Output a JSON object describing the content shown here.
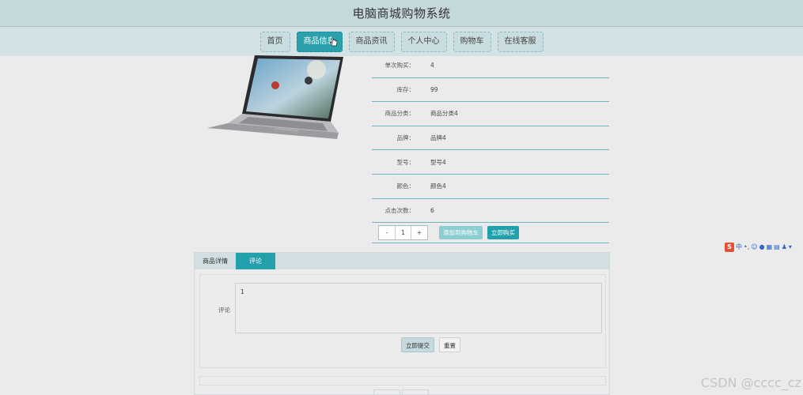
{
  "header": {
    "title": "电脑商城购物系统"
  },
  "nav": [
    {
      "label": "首页"
    },
    {
      "label": "商品信息"
    },
    {
      "label": "商品资讯"
    },
    {
      "label": "个人中心"
    },
    {
      "label": "购物车"
    },
    {
      "label": "在线客服"
    }
  ],
  "nav_active": 1,
  "product": {
    "specs": [
      {
        "key": "单次购买：",
        "value": "4"
      },
      {
        "key": "库存：",
        "value": "99"
      },
      {
        "key": "商品分类：",
        "value": "商品分类4"
      },
      {
        "key": "品牌：",
        "value": "品牌4"
      },
      {
        "key": "型号：",
        "value": "型号4"
      },
      {
        "key": "颜色：",
        "value": "颜色4"
      },
      {
        "key": "点击次数：",
        "value": "6"
      }
    ]
  },
  "purchase": {
    "minus": "-",
    "quantity": "1",
    "plus": "+",
    "add_to_cart": "添加到购物车",
    "buy_now": "立即购买"
  },
  "tabs": [
    {
      "label": "商品详情"
    },
    {
      "label": "评论"
    }
  ],
  "comment": {
    "label": "评论",
    "value": "1",
    "submit": "立即提交",
    "reset": "重置"
  },
  "ime": {
    "mode": "中"
  },
  "watermark": "CSDN @cccc_cz",
  "colors": {
    "accent": "#22a0ab",
    "nav_bg": "#d2e2e5",
    "title_bg": "#c5d8dc"
  }
}
